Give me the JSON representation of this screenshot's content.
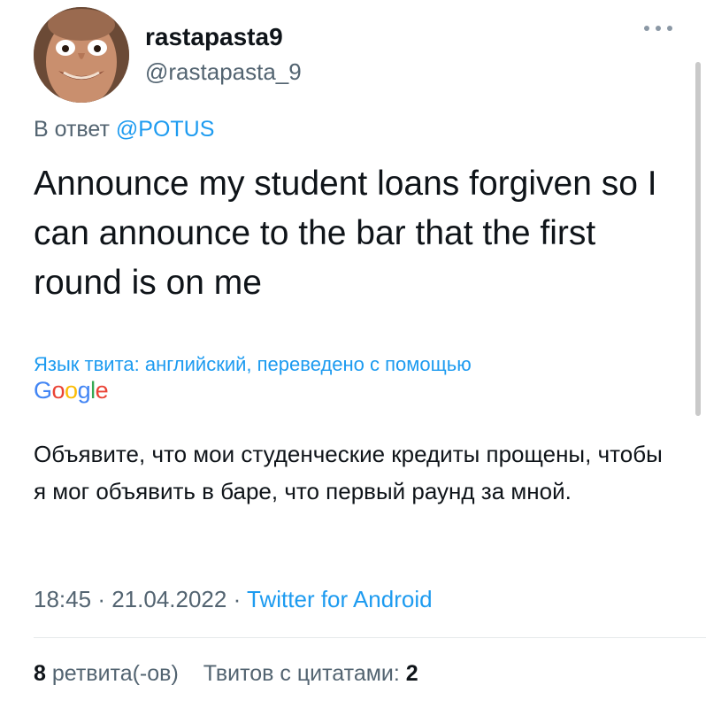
{
  "author": {
    "display_name": "rastapasta9",
    "handle": "@rastapasta_9"
  },
  "reply": {
    "prefix": "В ответ",
    "mention": "@POTUS"
  },
  "tweet": {
    "text": "Announce my student loans forgiven so I can announce to the bar that the first round is on me"
  },
  "translation": {
    "note": "Язык твита: английский, переведено с помощью",
    "provider": "Google",
    "text": "Объявите, что мои студенческие кредиты прощены, чтобы я мог объявить в баре, что первый раунд за мной."
  },
  "meta": {
    "time": "18:45",
    "separator": "·",
    "date": "21.04.2022",
    "source": "Twitter for Android"
  },
  "stats": {
    "retweets_count": "8",
    "retweets_label": "ретвита(-ов)",
    "quotes_label": "Твитов с цитатами:",
    "quotes_count": "2"
  },
  "colors": {
    "accent": "#1d9bf0",
    "secondary_text": "#536471",
    "primary_text": "#0f1419"
  },
  "icons": {
    "more": "more-horizontal-icon",
    "avatar": "user-avatar-face"
  }
}
